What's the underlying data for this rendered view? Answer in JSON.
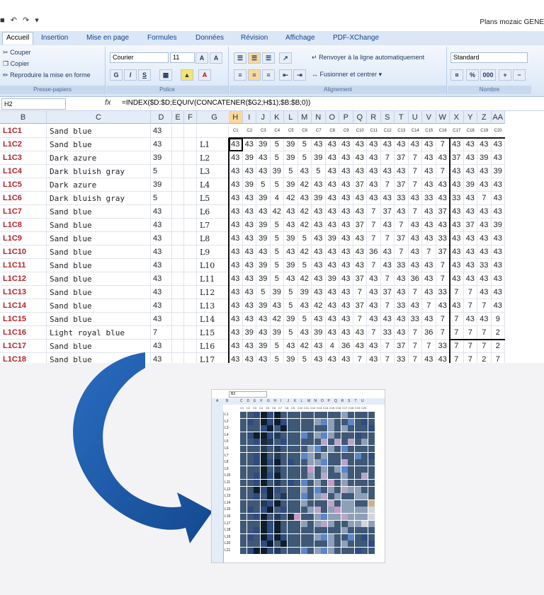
{
  "window": {
    "title": "Plans mozaic GENE",
    "quick_access": [
      "save-icon",
      "undo-icon",
      "redo-icon",
      "more-icon"
    ]
  },
  "ribbon": {
    "tabs": [
      "Accueil",
      "Insertion",
      "Mise en page",
      "Formules",
      "Données",
      "Révision",
      "Affichage",
      "PDF-XChange"
    ],
    "active_tab": "Accueil",
    "clipboard": {
      "cut": "Couper",
      "copy": "Copier",
      "format_painter": "Reproduire la mise en forme",
      "label": "Presse-papiers"
    },
    "font": {
      "name": "Courier",
      "size": "11",
      "label": "Police",
      "bold": "G",
      "italic": "I",
      "underline": "S"
    },
    "alignment": {
      "wrap": "Renvoyer à la ligne automatiquement",
      "merge": "Fusionner et centrer",
      "label": "Alignement"
    },
    "number": {
      "format": "Standard",
      "percent": "%",
      "thousands": "000",
      "label": "Nombre"
    }
  },
  "formula_bar": {
    "cell": "H2",
    "fx": "fx",
    "formula": "=INDEX($D:$D;EQUIV(CONCATENER($G2;H$1);$B:$B;0))"
  },
  "columns": [
    "B",
    "C",
    "D",
    "E",
    "F",
    "G",
    "H",
    "I",
    "J",
    "K",
    "L",
    "M",
    "N",
    "O",
    "P",
    "Q",
    "R",
    "S",
    "T",
    "U",
    "V",
    "W",
    "X",
    "Y",
    "Z",
    "AA"
  ],
  "selected_column": "H",
  "sub_headers": [
    "C1",
    "C2",
    "C3",
    "C4",
    "C5",
    "C6",
    "C7",
    "C8",
    "C9",
    "C10",
    "C11",
    "C12",
    "C13",
    "C14",
    "C15",
    "C16",
    "C17",
    "C18",
    "C19",
    "C20"
  ],
  "rows": [
    {
      "b": "L1C2",
      "c": "Sand blue",
      "d": "43",
      "g": "L1",
      "v": [
        "43",
        "43",
        "39",
        "5",
        "39",
        "5",
        "43",
        "43",
        "43",
        "43",
        "43",
        "43",
        "43",
        "43",
        "43",
        "7",
        "43",
        "43",
        "43",
        "43"
      ]
    },
    {
      "b": "L1C3",
      "c": "Dark azure",
      "d": "39",
      "g": "L2",
      "v": [
        "43",
        "39",
        "43",
        "5",
        "39",
        "5",
        "39",
        "43",
        "43",
        "43",
        "43",
        "7",
        "37",
        "7",
        "43",
        "43",
        "37",
        "43",
        "39",
        "43"
      ]
    },
    {
      "b": "L1C4",
      "c": "Dark bluish gray",
      "d": "5",
      "g": "L3",
      "v": [
        "43",
        "43",
        "43",
        "39",
        "5",
        "43",
        "5",
        "43",
        "43",
        "43",
        "43",
        "43",
        "43",
        "7",
        "43",
        "7",
        "43",
        "43",
        "43",
        "39"
      ]
    },
    {
      "b": "L1C5",
      "c": "Dark azure",
      "d": "39",
      "g": "L4",
      "v": [
        "43",
        "39",
        "5",
        "5",
        "39",
        "42",
        "43",
        "43",
        "43",
        "37",
        "43",
        "7",
        "37",
        "7",
        "43",
        "43",
        "43",
        "39",
        "43",
        "43"
      ]
    },
    {
      "b": "L1C6",
      "c": "Dark bluish gray",
      "d": "5",
      "g": "L5",
      "v": [
        "43",
        "43",
        "39",
        "4",
        "42",
        "43",
        "39",
        "43",
        "43",
        "43",
        "43",
        "43",
        "33",
        "43",
        "33",
        "43",
        "33",
        "43",
        "7",
        "43"
      ]
    },
    {
      "b": "L1C7",
      "c": "Sand blue",
      "d": "43",
      "g": "L6",
      "v": [
        "43",
        "43",
        "43",
        "42",
        "43",
        "42",
        "43",
        "43",
        "43",
        "43",
        "7",
        "37",
        "43",
        "7",
        "43",
        "37",
        "43",
        "43",
        "43",
        "43"
      ]
    },
    {
      "b": "L1C8",
      "c": "Sand blue",
      "d": "43",
      "g": "L7",
      "v": [
        "43",
        "43",
        "39",
        "5",
        "43",
        "42",
        "43",
        "43",
        "43",
        "37",
        "7",
        "43",
        "7",
        "43",
        "43",
        "43",
        "43",
        "37",
        "43",
        "39"
      ]
    },
    {
      "b": "L1C9",
      "c": "Sand blue",
      "d": "43",
      "g": "L8",
      "v": [
        "43",
        "43",
        "39",
        "5",
        "39",
        "5",
        "43",
        "39",
        "43",
        "43",
        "7",
        "7",
        "37",
        "43",
        "43",
        "33",
        "43",
        "43",
        "43",
        "43"
      ]
    },
    {
      "b": "L1C10",
      "c": "Sand blue",
      "d": "43",
      "g": "L9",
      "v": [
        "43",
        "43",
        "43",
        "5",
        "43",
        "42",
        "43",
        "43",
        "43",
        "43",
        "36",
        "43",
        "7",
        "43",
        "7",
        "37",
        "43",
        "43",
        "43",
        "43"
      ]
    },
    {
      "b": "L1C11",
      "c": "Sand blue",
      "d": "43",
      "g": "L10",
      "v": [
        "43",
        "43",
        "39",
        "5",
        "39",
        "5",
        "43",
        "43",
        "43",
        "43",
        "7",
        "43",
        "33",
        "43",
        "43",
        "7",
        "43",
        "43",
        "33",
        "43"
      ]
    },
    {
      "b": "L1C12",
      "c": "Sand blue",
      "d": "43",
      "g": "L11",
      "v": [
        "43",
        "43",
        "39",
        "5",
        "43",
        "42",
        "43",
        "39",
        "43",
        "37",
        "43",
        "7",
        "43",
        "36",
        "43",
        "7",
        "43",
        "43",
        "43",
        "43"
      ]
    },
    {
      "b": "L1C13",
      "c": "Sand blue",
      "d": "43",
      "g": "L12",
      "v": [
        "43",
        "43",
        "5",
        "39",
        "5",
        "39",
        "43",
        "43",
        "43",
        "7",
        "43",
        "37",
        "43",
        "7",
        "43",
        "33",
        "7",
        "7",
        "43",
        "43"
      ]
    },
    {
      "b": "L1C14",
      "c": "Sand blue",
      "d": "43",
      "g": "L13",
      "v": [
        "43",
        "43",
        "39",
        "43",
        "5",
        "43",
        "42",
        "43",
        "43",
        "37",
        "43",
        "7",
        "33",
        "43",
        "7",
        "43",
        "43",
        "7",
        "7",
        "43"
      ]
    },
    {
      "b": "L1C15",
      "c": "Sand blue",
      "d": "43",
      "g": "L14",
      "v": [
        "43",
        "43",
        "43",
        "42",
        "39",
        "5",
        "43",
        "43",
        "43",
        "7",
        "43",
        "43",
        "43",
        "33",
        "43",
        "7",
        "7",
        "43",
        "43",
        "9"
      ]
    },
    {
      "b": "L1C16",
      "c": "Light royal blue",
      "d": "7",
      "g": "L15",
      "v": [
        "43",
        "39",
        "43",
        "39",
        "5",
        "43",
        "39",
        "43",
        "43",
        "43",
        "7",
        "33",
        "43",
        "7",
        "36",
        "7",
        "7",
        "7",
        "7",
        "2"
      ]
    },
    {
      "b": "L1C17",
      "c": "Sand blue",
      "d": "43",
      "g": "L16",
      "v": [
        "43",
        "43",
        "39",
        "5",
        "43",
        "42",
        "43",
        "4",
        "36",
        "43",
        "43",
        "7",
        "37",
        "7",
        "7",
        "33",
        "7",
        "7",
        "7",
        "2"
      ]
    },
    {
      "b": "L1C18",
      "c": "Sand blue",
      "d": "43",
      "g": "L17",
      "v": [
        "43",
        "43",
        "43",
        "5",
        "39",
        "5",
        "43",
        "43",
        "43",
        "7",
        "43",
        "7",
        "33",
        "7",
        "43",
        "43",
        "7",
        "7",
        "2",
        "7"
      ]
    }
  ],
  "header_row": {
    "b": "L1C1",
    "c": "Sand blue",
    "d": "43"
  },
  "mini_preview": {
    "cell": "B2",
    "columns": [
      "A",
      "B",
      "C",
      "D",
      "E",
      "F",
      "G",
      "H",
      "I",
      "J",
      "K",
      "L",
      "M",
      "N",
      "O",
      "P",
      "Q",
      "R",
      "S",
      "T",
      "U"
    ],
    "row_labels": [
      "L1",
      "L2",
      "L3",
      "L4",
      "L5",
      "L6",
      "L7",
      "L8",
      "L9",
      "L10",
      "L11",
      "L12",
      "L13",
      "L14",
      "L15",
      "L16",
      "L17",
      "L18",
      "L19",
      "L20",
      "L21"
    ],
    "palette": {
      "43": "#3f5876",
      "39": "#2f4c80",
      "5": "#0d1d2e",
      "42": "#223a5a",
      "7": "#8e9fb8",
      "37": "#5b86c9",
      "33": "#b8a6c6",
      "36": "#c49ac8",
      "4": "#1a2a3c",
      "9": "#c8b48c",
      "2": "#d2d6dc"
    }
  },
  "colors": {
    "row_label_red": "#b3242a",
    "ribbon_blue": "#dbe7f6",
    "arrow_blue": "#1e5aa8"
  }
}
